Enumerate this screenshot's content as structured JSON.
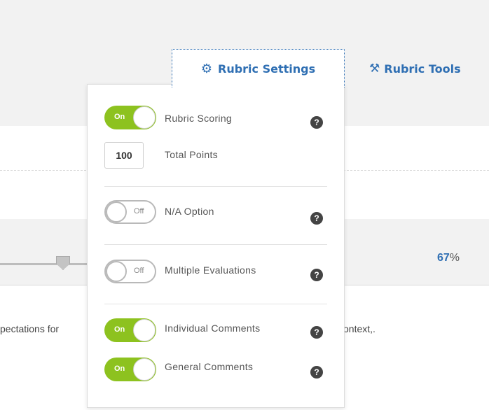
{
  "tabs": {
    "settings": {
      "icon": "⚙",
      "label": "Rubric Settings"
    },
    "tools": {
      "icon": "⚒",
      "label": "Rubric Tools"
    }
  },
  "background": {
    "percent_value": "67",
    "percent_sign": "%",
    "text_left": "pectations for",
    "text_right": "ontext,."
  },
  "settings": {
    "rubric_scoring": {
      "label": "Rubric Scoring",
      "state": "On"
    },
    "total_points": {
      "value": "100",
      "label": "Total Points"
    },
    "na_option": {
      "label": "N/A Option",
      "state": "Off"
    },
    "multiple_evaluations": {
      "label": "Multiple Evaluations",
      "state": "Off"
    },
    "individual_comments": {
      "label": "Individual Comments",
      "state": "On"
    },
    "general_comments": {
      "label": "General Comments",
      "state": "On"
    }
  },
  "help_icon": "?",
  "colors": {
    "accent": "#2f6fb3",
    "toggle_on": "#8dc21f"
  }
}
